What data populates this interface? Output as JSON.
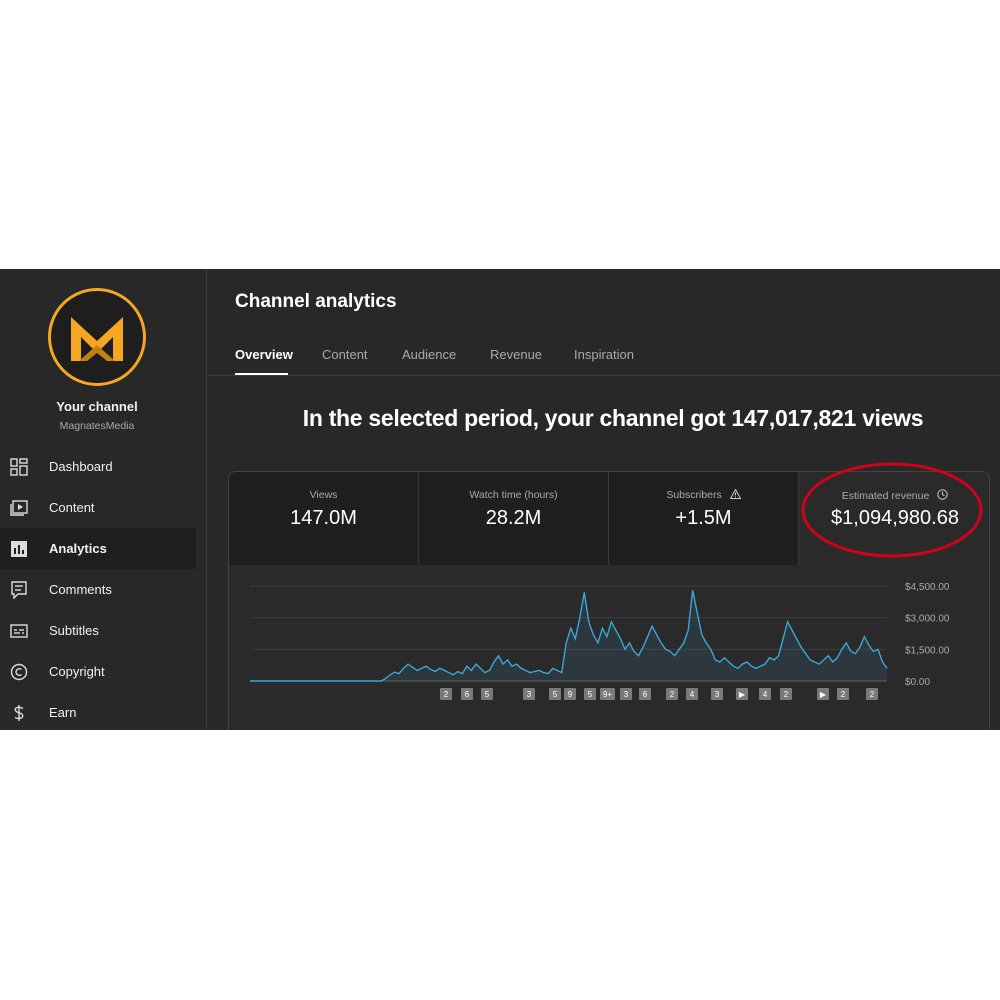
{
  "sidebar": {
    "channel_title": "Your channel",
    "channel_handle": "MagnatesMedia",
    "items": [
      {
        "label": "Dashboard",
        "icon": "dashboard-icon"
      },
      {
        "label": "Content",
        "icon": "content-icon"
      },
      {
        "label": "Analytics",
        "icon": "analytics-icon",
        "active": true
      },
      {
        "label": "Comments",
        "icon": "comments-icon"
      },
      {
        "label": "Subtitles",
        "icon": "subtitles-icon"
      },
      {
        "label": "Copyright",
        "icon": "copyright-icon"
      },
      {
        "label": "Earn",
        "icon": "dollar-icon"
      }
    ]
  },
  "header": {
    "title": "Channel analytics",
    "tabs": [
      "Overview",
      "Content",
      "Audience",
      "Revenue",
      "Inspiration"
    ],
    "active_tab": "Overview"
  },
  "headline": "In the selected period, your channel got 147,017,821 views",
  "metrics": [
    {
      "label": "Views",
      "value": "147.0M"
    },
    {
      "label": "Watch time (hours)",
      "value": "28.2M"
    },
    {
      "label": "Subscribers",
      "value": "+1.5M",
      "icon": "warning-icon"
    },
    {
      "label": "Estimated revenue",
      "value": "$1,094,980.68",
      "icon": "clock-icon",
      "selected": true
    }
  ],
  "colors": {
    "accent_line": "#3ea6d6",
    "highlight_circle": "#d0021b",
    "logo": "#f5a623"
  },
  "chart_data": {
    "type": "area",
    "series": [
      {
        "values": [
          0,
          0,
          0,
          0,
          0,
          0,
          0,
          0,
          0,
          0,
          0,
          0,
          0,
          0,
          0,
          0,
          0,
          0,
          0,
          0,
          0,
          0,
          0,
          0,
          0,
          0,
          0,
          0,
          0,
          0,
          120,
          280,
          420,
          350,
          600,
          800,
          650,
          500,
          600,
          700,
          550,
          450,
          600,
          500,
          400,
          300,
          450,
          350,
          700,
          500,
          800,
          600,
          400,
          500,
          900,
          1200,
          800,
          1000,
          700,
          800,
          600,
          500,
          400,
          450,
          500,
          400,
          350,
          600,
          500,
          400,
          1800,
          2500,
          2000,
          3000,
          4200,
          2800,
          2200,
          1800,
          2500,
          2100,
          2800,
          2400,
          2000,
          1500,
          1800,
          1400,
          1200,
          1600,
          2100,
          2600,
          2200,
          1800,
          1500,
          1400,
          1200,
          1500,
          1800,
          2400,
          4300,
          3200,
          2200,
          1800,
          1500,
          1000,
          900,
          1100,
          900,
          700,
          600,
          800,
          900,
          700,
          600,
          700,
          800,
          1100,
          1000,
          1200,
          2000,
          2800,
          2400,
          2000,
          1600,
          1300,
          1000,
          900,
          800,
          1000,
          1200,
          900,
          1100,
          1500,
          1800,
          1400,
          1300,
          1600,
          2100,
          1700,
          1400,
          1500,
          900,
          600
        ]
      }
    ],
    "ylim": [
      0,
      4500
    ],
    "y_ticks": [
      "$0.00",
      "$1,500.00",
      "$3,000.00",
      "$4,500.00"
    ],
    "markers": [
      "2",
      "6",
      "5",
      "3",
      "5",
      "9",
      "5",
      "9+",
      "3",
      "6",
      "2",
      "4",
      "3",
      "▶",
      "4",
      "2",
      "▶",
      "2",
      "2"
    ]
  }
}
